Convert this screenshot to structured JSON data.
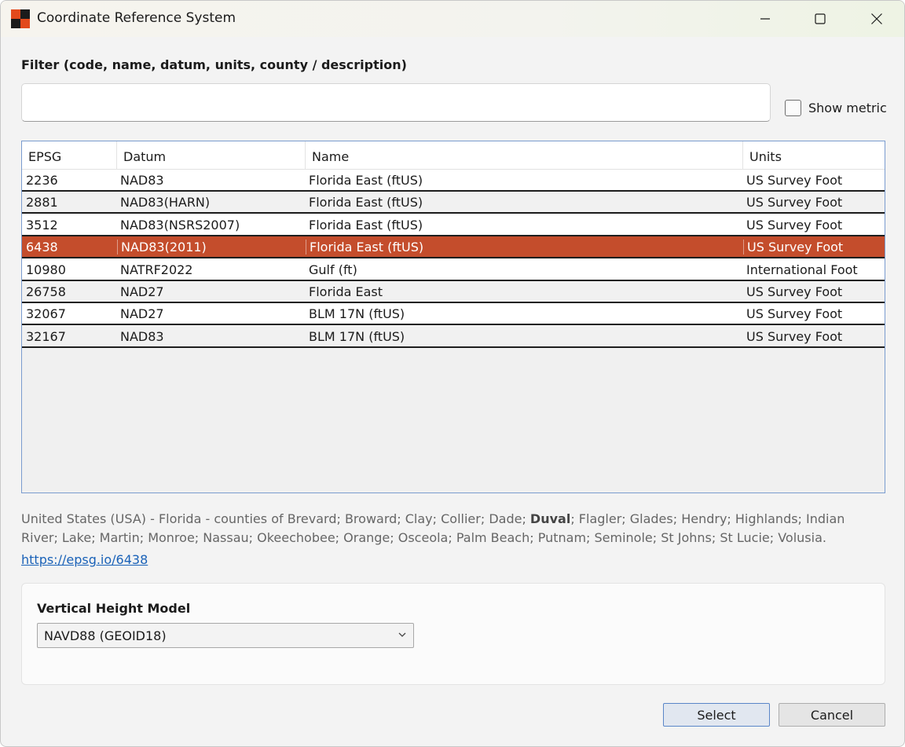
{
  "window": {
    "title": "Coordinate Reference System",
    "icons": {
      "app": "app-logo-icon",
      "minimize": "minimize-icon",
      "maximize": "maximize-icon",
      "close": "close-icon"
    },
    "accent": "#c44d2c"
  },
  "filter": {
    "label": "Filter (code, name, datum, units, county / description)",
    "value": "",
    "placeholder": ""
  },
  "show_metric": {
    "label": "Show metric",
    "checked": false
  },
  "table": {
    "columns": [
      "EPSG",
      "Datum",
      "Name",
      "Units"
    ],
    "rows": [
      {
        "epsg": "2236",
        "datum": "NAD83",
        "name": "Florida East (ftUS)",
        "units": "US Survey Foot"
      },
      {
        "epsg": "2881",
        "datum": "NAD83(HARN)",
        "name": "Florida East (ftUS)",
        "units": "US Survey Foot"
      },
      {
        "epsg": "3512",
        "datum": "NAD83(NSRS2007)",
        "name": "Florida East (ftUS)",
        "units": "US Survey Foot"
      },
      {
        "epsg": "6438",
        "datum": "NAD83(2011)",
        "name": "Florida East (ftUS)",
        "units": "US Survey Foot",
        "selected": true
      },
      {
        "epsg": "10980",
        "datum": "NATRF2022",
        "name": "Gulf (ft)",
        "units": "International Foot"
      },
      {
        "epsg": "26758",
        "datum": "NAD27",
        "name": "Florida East",
        "units": "US Survey Foot"
      },
      {
        "epsg": "32067",
        "datum": "NAD27",
        "name": "BLM 17N (ftUS)",
        "units": "US Survey Foot"
      },
      {
        "epsg": "32167",
        "datum": "NAD83",
        "name": "BLM 17N (ftUS)",
        "units": "US Survey Foot"
      }
    ]
  },
  "description": {
    "before": "United States (USA) - Florida - counties of Brevard; Broward; Clay; Collier; Dade; ",
    "highlight": "Duval",
    "after": "; Flagler; Glades; Hendry; Highlands; Indian River; Lake; Martin; Monroe; Nassau; Okeechobee; Orange; Osceola; Palm Beach; Putnam; Seminole; St Johns; St Lucie; Volusia."
  },
  "link": {
    "text": "https://epsg.io/6438"
  },
  "vertical": {
    "label": "Vertical Height Model",
    "selected": "NAVD88 (GEOID18)"
  },
  "buttons": {
    "select": "Select",
    "cancel": "Cancel"
  }
}
